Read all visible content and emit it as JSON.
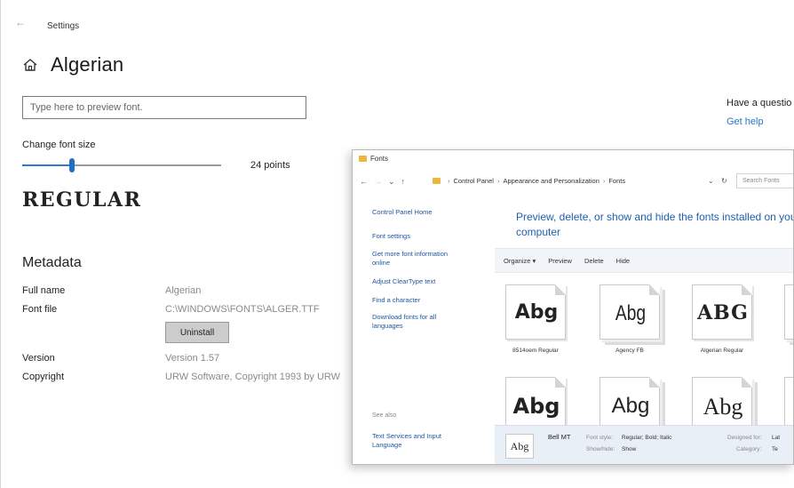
{
  "settings": {
    "title": "Settings",
    "font_name": "Algerian",
    "preview_placeholder": "Type here to preview font.",
    "size_label": "Change font size",
    "size_value": "24 points",
    "size_slider_fraction": 0.25,
    "style_preview": "REGULAR",
    "metadata_heading": "Metadata",
    "metadata": {
      "full_name_label": "Full name",
      "full_name_value": "Algerian",
      "font_file_label": "Font file",
      "font_file_value": "C:\\WINDOWS\\FONTS\\ALGER.TTF",
      "uninstall_label": "Uninstall",
      "version_label": "Version",
      "version_value": "Version 1.57",
      "copyright_label": "Copyright",
      "copyright_value": "URW Software, Copyright 1993 by URW"
    },
    "help": {
      "title": "Have a questio",
      "link": "Get help"
    },
    "accent_color": "#1f6fc6"
  },
  "fonts_window": {
    "title": "Fonts",
    "address": {
      "parts": [
        "Control Panel",
        "Appearance and Personalization",
        "Fonts"
      ]
    },
    "search_placeholder": "Search Fonts",
    "left_links": [
      "Control Panel Home",
      "Font settings",
      "Get more font information online",
      "Adjust ClearType text",
      "Find a character",
      "Download fonts for all languages"
    ],
    "see_also": "See also",
    "see_also_links": [
      "Text Services and Input Language"
    ],
    "heading": "Preview, delete, or show and hide the fonts installed on your computer",
    "commands": [
      "Organize",
      "Preview",
      "Delete",
      "Hide"
    ],
    "tiles": [
      {
        "glyph": "Abg",
        "name": "8514oem Regular"
      },
      {
        "glyph": "Abg",
        "name": "Agency FB"
      },
      {
        "glyph": "ABG",
        "name": "Algerian Regular"
      },
      {
        "glyph": "Abg",
        "name": ""
      },
      {
        "glyph": "Abg",
        "name": ""
      },
      {
        "glyph": "Abg",
        "name": ""
      }
    ],
    "details": {
      "thumb_glyph": "Abg",
      "name": "Bell MT",
      "style_label": "Font style:",
      "style_value": "Regular; Bold; Italic",
      "show_label": "Show/hide:",
      "show_value": "Show",
      "designed_label": "Designed for:",
      "designed_value": "Lat",
      "category_label": "Category:",
      "category_value": "Te"
    }
  }
}
